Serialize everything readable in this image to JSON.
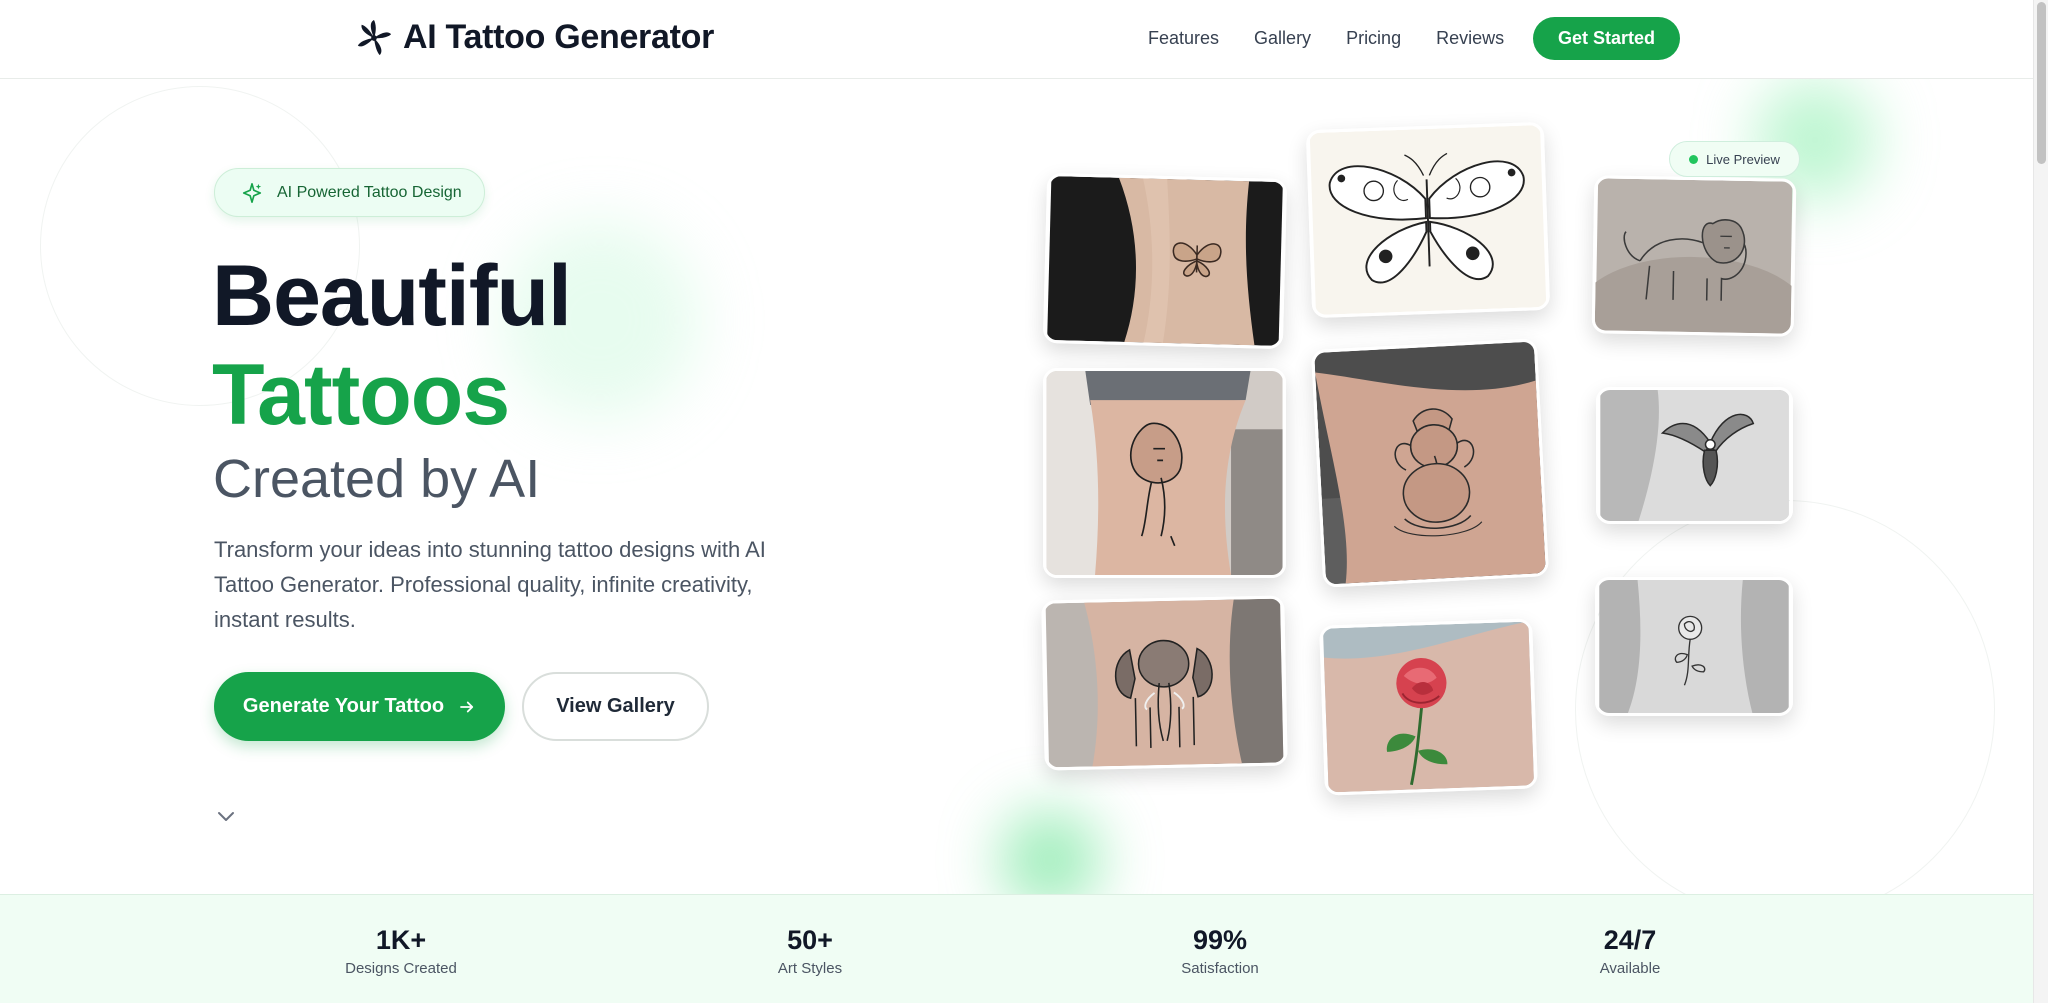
{
  "header": {
    "brand": "AI Tattoo Generator",
    "nav": [
      "Features",
      "Gallery",
      "Pricing",
      "Reviews"
    ],
    "cta": "Get Started"
  },
  "hero": {
    "badge": "AI Powered Tattoo Design",
    "title_line1": "Beautiful",
    "title_line2": "Tattoos",
    "title_line3": "Created by AI",
    "description": "Transform your ideas into stunning tattoo designs with AI Tattoo Generator. Professional quality, infinite creativity, instant results.",
    "primary_button": "Generate Your Tattoo",
    "secondary_button": "View Gallery"
  },
  "gallery": {
    "live_preview": "Live Preview",
    "images": [
      "butterfly-wrist-tattoo",
      "butterfly-sketch",
      "lion-chest-tattoo",
      "lion-forearm-tattoo",
      "ganesha-forearm-tattoo",
      "eagle-arm-tattoo",
      "elephant-forearm-tattoo",
      "red-rose-tattoo",
      "rose-wrist-tattoo"
    ]
  },
  "stats": [
    {
      "value": "1K+",
      "label": "Designs Created"
    },
    {
      "value": "50+",
      "label": "Art Styles"
    },
    {
      "value": "99%",
      "label": "Satisfaction"
    },
    {
      "value": "24/7",
      "label": "Available"
    }
  ],
  "colors": {
    "brand_green": "#16a34a",
    "dark_text": "#111827",
    "muted_text": "#4b5563",
    "stats_bg": "#f0fdf4"
  }
}
